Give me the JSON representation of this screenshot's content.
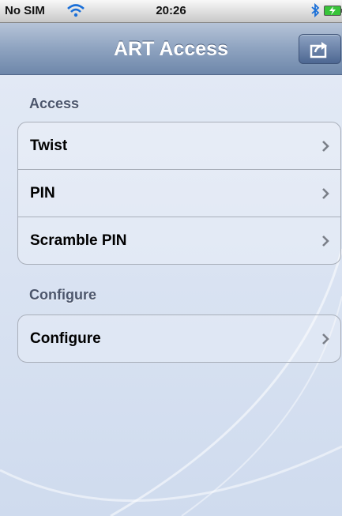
{
  "status_bar": {
    "carrier": "No SIM",
    "time": "20:26",
    "icons": [
      "wifi-icon",
      "bluetooth-icon",
      "battery-charging-icon"
    ]
  },
  "nav_bar": {
    "title": "ART Access",
    "right_button_icon": "share-action-icon"
  },
  "sections": [
    {
      "header": "Access",
      "items": [
        {
          "label": "Twist",
          "icon": "chevron-right-icon"
        },
        {
          "label": "PIN",
          "icon": "chevron-right-icon"
        },
        {
          "label": "Scramble PIN",
          "icon": "chevron-right-icon"
        }
      ]
    },
    {
      "header": "Configure",
      "items": [
        {
          "label": "Configure",
          "icon": "chevron-right-icon"
        }
      ]
    }
  ],
  "colors": {
    "nav_top": "#b6c4d8",
    "nav_bottom": "#6e87aa",
    "background": "#dfe7f4",
    "section_header": "#4c566c",
    "battery_green": "#38c43a"
  }
}
